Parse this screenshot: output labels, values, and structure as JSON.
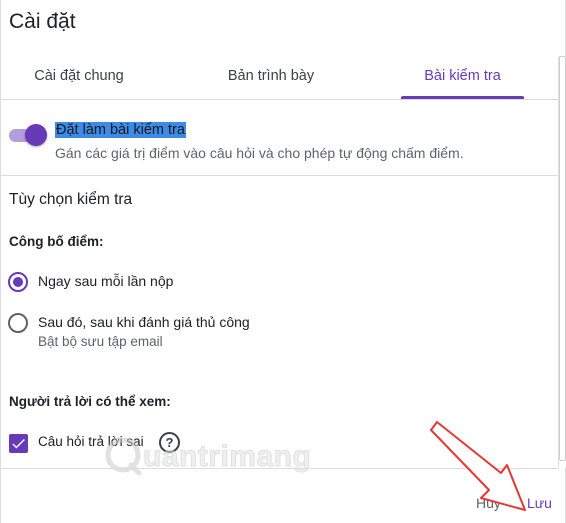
{
  "dialog": {
    "title": "Cài đặt",
    "tabs": [
      {
        "label": "Cài đặt chung"
      },
      {
        "label": "Bản trình bày"
      },
      {
        "label": "Bài kiểm tra"
      }
    ],
    "active_tab": "Bài kiểm tra",
    "accent_color": "#673ab7"
  },
  "quiz": {
    "toggle_on": true,
    "title": "Đặt làm bài kiểm tra",
    "description": "Gán các giá trị điểm vào câu hỏi và cho phép tự động chấm điểm."
  },
  "options": {
    "section_title": "Tùy chọn kiểm tra",
    "release_label": "Công bố điểm:",
    "release_options": [
      {
        "label": "Ngay sau mỗi lần nộp",
        "selected": true
      },
      {
        "label": "Sau đó, sau khi đánh giá thủ công",
        "selected": false,
        "sublabel": "Bật bộ sưu tập email"
      }
    ],
    "respondent_label": "Người trả lời có thể xem:",
    "respondent_items": [
      {
        "label": "Câu hỏi trả lời sai",
        "checked": true,
        "help_icon": "help-circle-icon"
      }
    ]
  },
  "watermark": {
    "text": "uantrimang"
  },
  "footer": {
    "cancel_label": "Hủy",
    "save_label": "Lưu"
  },
  "annotation": {
    "type": "red-arrow",
    "color": "#e53935",
    "points_to": "Lưu"
  }
}
